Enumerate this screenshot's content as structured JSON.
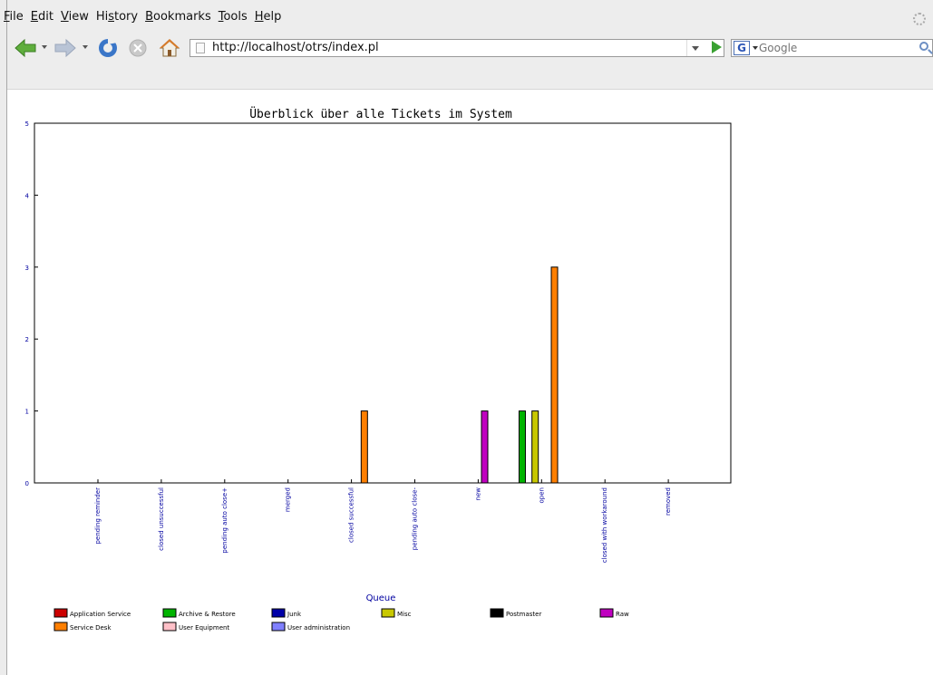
{
  "browser": {
    "menu": [
      "File",
      "Edit",
      "View",
      "History",
      "Bookmarks",
      "Tools",
      "Help"
    ],
    "menu_access_keys": [
      "F",
      "E",
      "V",
      "s",
      "B",
      "T",
      "H"
    ],
    "url": "http://localhost/otrs/index.pl",
    "search_engine": "G",
    "search_placeholder": "Google"
  },
  "colors": {
    "back_arrow": "#5fae3d",
    "forward_arrow": "#b9c4d6",
    "reload": "#3a76c8",
    "stop": "#c9c9c9",
    "home": "#d57b2b",
    "go_button": "#3aa132"
  },
  "chart_data": {
    "type": "bar",
    "title": "Überblick über alle Tickets im System",
    "xlabel": "Queue",
    "ylabel": "",
    "ylim": [
      0,
      5
    ],
    "yticks": [
      0,
      1,
      2,
      3,
      4,
      5
    ],
    "categories": [
      "pending reminder",
      "closed unsuccessful",
      "pending auto close+",
      "merged",
      "closed successful",
      "pending auto close-",
      "new",
      "open",
      "closed with workaround",
      "removed"
    ],
    "series": [
      {
        "name": "Application Service",
        "color": "#cc0000",
        "values": [
          0,
          0,
          0,
          0,
          0,
          0,
          0,
          0,
          0,
          0
        ]
      },
      {
        "name": "Archive & Restore",
        "color": "#00b400",
        "values": [
          0,
          0,
          0,
          0,
          0,
          0,
          0,
          1,
          0,
          0
        ]
      },
      {
        "name": "Junk",
        "color": "#0000a8",
        "values": [
          0,
          0,
          0,
          0,
          0,
          0,
          0,
          0,
          0,
          0
        ]
      },
      {
        "name": "Misc",
        "color": "#c8c800",
        "values": [
          0,
          0,
          0,
          0,
          0,
          0,
          0,
          1,
          0,
          0
        ]
      },
      {
        "name": "Postmaster",
        "color": "#000000",
        "values": [
          0,
          0,
          0,
          0,
          0,
          0,
          0,
          0,
          0,
          0
        ]
      },
      {
        "name": "Raw",
        "color": "#c000c0",
        "values": [
          0,
          0,
          0,
          0,
          0,
          0,
          1,
          0,
          0,
          0
        ]
      },
      {
        "name": "Service Desk",
        "color": "#ff7f00",
        "values": [
          0,
          0,
          0,
          0,
          1,
          0,
          0,
          3,
          0,
          0
        ]
      },
      {
        "name": "User Equipment",
        "color": "#ffc0c8",
        "values": [
          0,
          0,
          0,
          0,
          0,
          0,
          0,
          0,
          0,
          0
        ]
      },
      {
        "name": "User administration",
        "color": "#8080ff",
        "values": [
          0,
          0,
          0,
          0,
          0,
          0,
          0,
          0,
          0,
          0
        ]
      }
    ],
    "grid": false,
    "legend_position": "bottom"
  }
}
